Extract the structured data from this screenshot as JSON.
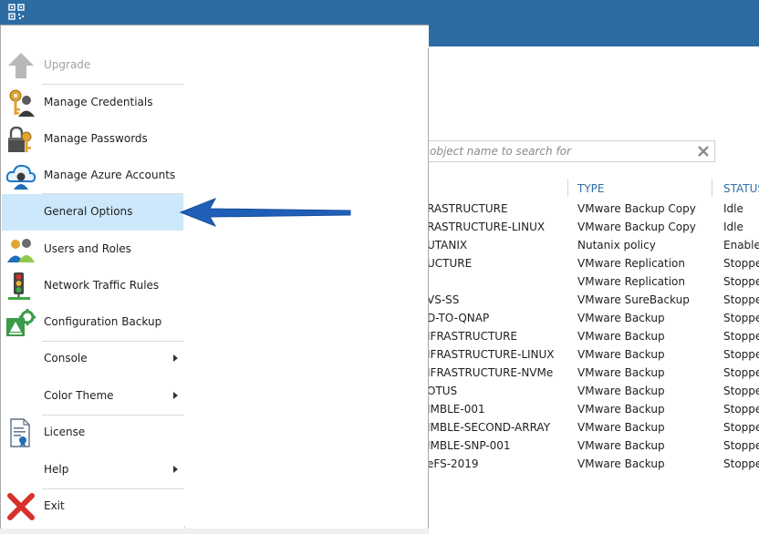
{
  "app": {
    "logo_icon": "veeam-logo-icon",
    "menu_button_icon": "hamburger-menu-icon"
  },
  "colors": {
    "titlebar": "#2d6ca3",
    "highlight": "#cde8fb",
    "header_text": "#2f6ea8",
    "arrow": "#1f5fb8"
  },
  "search": {
    "placeholder": "object name to search for"
  },
  "table": {
    "columns": [
      "TYPE",
      "STATUS"
    ],
    "rows": [
      {
        "name": "RASTRUCTURE",
        "type": "VMware Backup Copy",
        "status": "Idle"
      },
      {
        "name": "RASTRUCTURE-LINUX",
        "type": "VMware Backup Copy",
        "status": "Idle"
      },
      {
        "name": "UTANIX",
        "type": "Nutanix policy",
        "status": "Enabled"
      },
      {
        "name": "UCTURE",
        "type": "VMware Replication",
        "status": "Stopped"
      },
      {
        "name": "",
        "type": "VMware Replication",
        "status": "Stopped"
      },
      {
        "name": "VS-SS",
        "type": "VMware SureBackup",
        "status": "Stopped"
      },
      {
        "name": "D-TO-QNAP",
        "type": "VMware Backup",
        "status": "Stopped"
      },
      {
        "name": "IFRASTRUCTURE",
        "type": "VMware Backup",
        "status": "Stopped"
      },
      {
        "name": "IFRASTRUCTURE-LINUX",
        "type": "VMware Backup",
        "status": "Stopped"
      },
      {
        "name": "IFRASTRUCTURE-NVMe",
        "type": "VMware Backup",
        "status": "Stopped"
      },
      {
        "name": "OTUS",
        "type": "VMware Backup",
        "status": "Stopped"
      },
      {
        "name": "IMBLE-001",
        "type": "VMware Backup",
        "status": "Stopped"
      },
      {
        "name": "IMBLE-SECOND-ARRAY",
        "type": "VMware Backup",
        "status": "Stopped"
      },
      {
        "name": "IMBLE-SNP-001",
        "type": "VMware Backup",
        "status": "Stopped"
      },
      {
        "name": "eFS-2019",
        "type": "VMware Backup",
        "status": "Stopped"
      }
    ]
  },
  "menu": {
    "items": [
      {
        "label": "Upgrade",
        "icon": "upgrade-arrow-icon",
        "disabled": true
      },
      {
        "label": "Manage Credentials",
        "icon": "key-user-icon"
      },
      {
        "label": "Manage Passwords",
        "icon": "lock-key-icon"
      },
      {
        "label": "Manage Azure Accounts",
        "icon": "cloud-user-icon"
      },
      {
        "label": "General Options",
        "icon": "",
        "selected": true
      },
      {
        "label": "Users and Roles",
        "icon": "users-icon"
      },
      {
        "label": "Network Traffic Rules",
        "icon": "traffic-light-icon"
      },
      {
        "label": "Configuration Backup",
        "icon": "config-backup-icon"
      },
      {
        "label": "Console",
        "icon": "",
        "submenu": true
      },
      {
        "label": "Color Theme",
        "icon": "",
        "submenu": true
      },
      {
        "label": "License",
        "icon": "license-certificate-icon"
      },
      {
        "label": "Help",
        "icon": "",
        "submenu": true
      },
      {
        "label": "Exit",
        "icon": "exit-x-icon"
      }
    ]
  }
}
